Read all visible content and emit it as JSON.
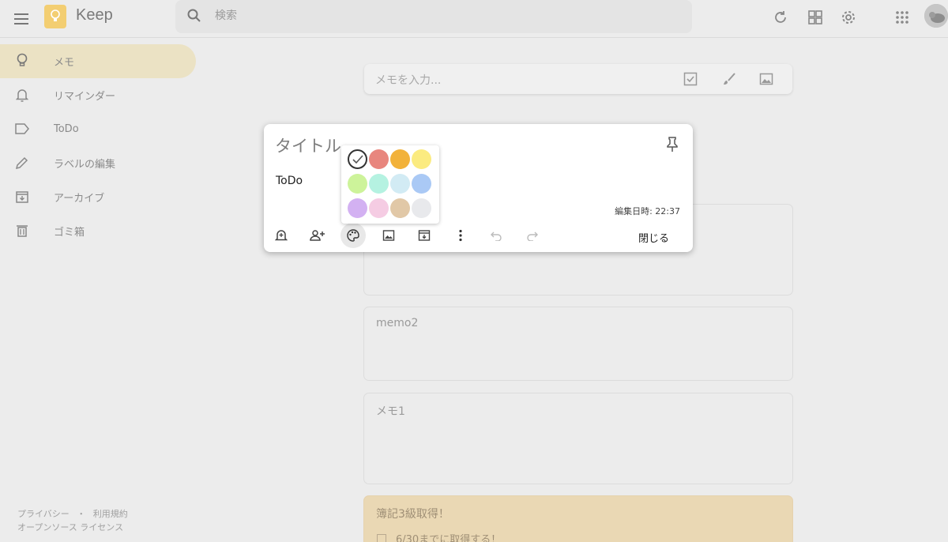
{
  "header": {
    "app_title": "Keep",
    "search_placeholder": "検索"
  },
  "sidebar": {
    "items": [
      {
        "label": "メモ",
        "icon": "lightbulb-icon",
        "active": true
      },
      {
        "label": "リマインダー",
        "icon": "bell-icon",
        "active": false
      },
      {
        "label": "ToDo",
        "icon": "label-icon",
        "active": false
      },
      {
        "label": "ラベルの編集",
        "icon": "pencil-icon",
        "active": false
      },
      {
        "label": "アーカイブ",
        "icon": "archive-icon",
        "active": false
      },
      {
        "label": "ゴミ箱",
        "icon": "trash-icon",
        "active": false
      }
    ],
    "footer": {
      "privacy": "プライバシー",
      "separator": "・",
      "terms": "利用規約",
      "oss": "オープンソース ライセンス"
    }
  },
  "take_note": {
    "placeholder": "メモを入力..."
  },
  "notes": [
    {
      "title": "memo2"
    },
    {
      "title": "メモ1"
    },
    {
      "title": "簿記3級取得！",
      "checklist": [
        "6/30までに取得する！"
      ],
      "color": "#ead8b4"
    }
  ],
  "dialog": {
    "title": "タイトル",
    "body": "ToDo",
    "edited": "編集日時: 22:37",
    "close_label": "閉じる"
  },
  "palette": {
    "colors": [
      "#ffffff",
      "#e8867e",
      "#f2b23a",
      "#fbeb80",
      "#cdf39a",
      "#b5f2e1",
      "#d2ebf4",
      "#aac9f5",
      "#d3b1f2",
      "#f5cce3",
      "#e1c8a7",
      "#e8e9ec"
    ]
  }
}
